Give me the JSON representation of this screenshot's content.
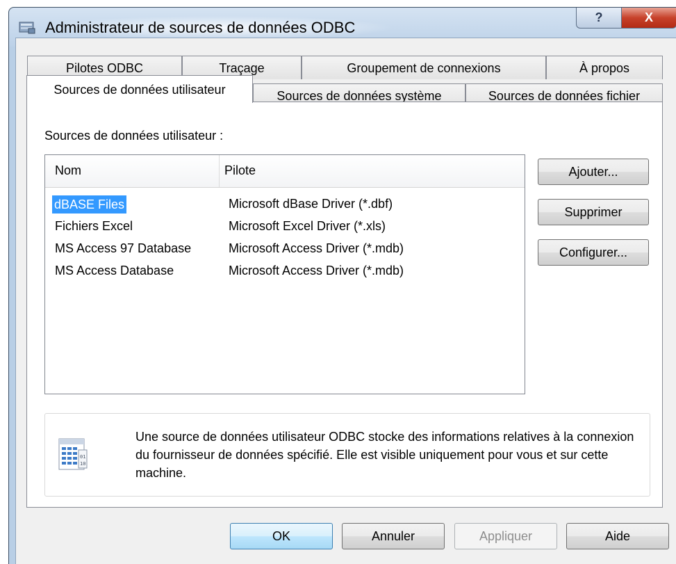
{
  "window": {
    "title": "Administrateur de sources de données ODBC",
    "help_label": "?",
    "close_label": "X"
  },
  "tabs": {
    "row1": [
      "Pilotes ODBC",
      "Traçage",
      "Groupement de connexions",
      "À propos"
    ],
    "row2": [
      "Sources de données utilisateur",
      "Sources de données système",
      "Sources de données fichier"
    ],
    "active": "Sources de données utilisateur"
  },
  "panel": {
    "section_label": "Sources de données utilisateur :",
    "columns": [
      "Nom",
      "Pilote"
    ],
    "rows": [
      {
        "name": "dBASE Files",
        "driver": "Microsoft dBase Driver (*.dbf)",
        "selected": true
      },
      {
        "name": "Fichiers Excel",
        "driver": "Microsoft Excel Driver (*.xls)"
      },
      {
        "name": "MS Access 97 Database",
        "driver": "Microsoft Access Driver (*.mdb)"
      },
      {
        "name": "MS Access Database",
        "driver": "Microsoft Access Driver (*.mdb)"
      }
    ],
    "buttons": {
      "add": "Ajouter...",
      "remove": "Supprimer",
      "configure": "Configurer..."
    },
    "info_text": "Une source de données utilisateur ODBC stocke des informations relatives à la connexion du fournisseur de données spécifié. Elle est visible uniquement pour vous et sur cette machine."
  },
  "footer": {
    "ok": "OK",
    "cancel": "Annuler",
    "apply": "Appliquer",
    "help": "Aide"
  },
  "colors": {
    "selection": "#3399ff",
    "close_button": "#c7422b",
    "frame": "#b9cfe6"
  },
  "icons": {
    "title": "odbc-admin-icon",
    "info": "data-source-document-icon"
  }
}
